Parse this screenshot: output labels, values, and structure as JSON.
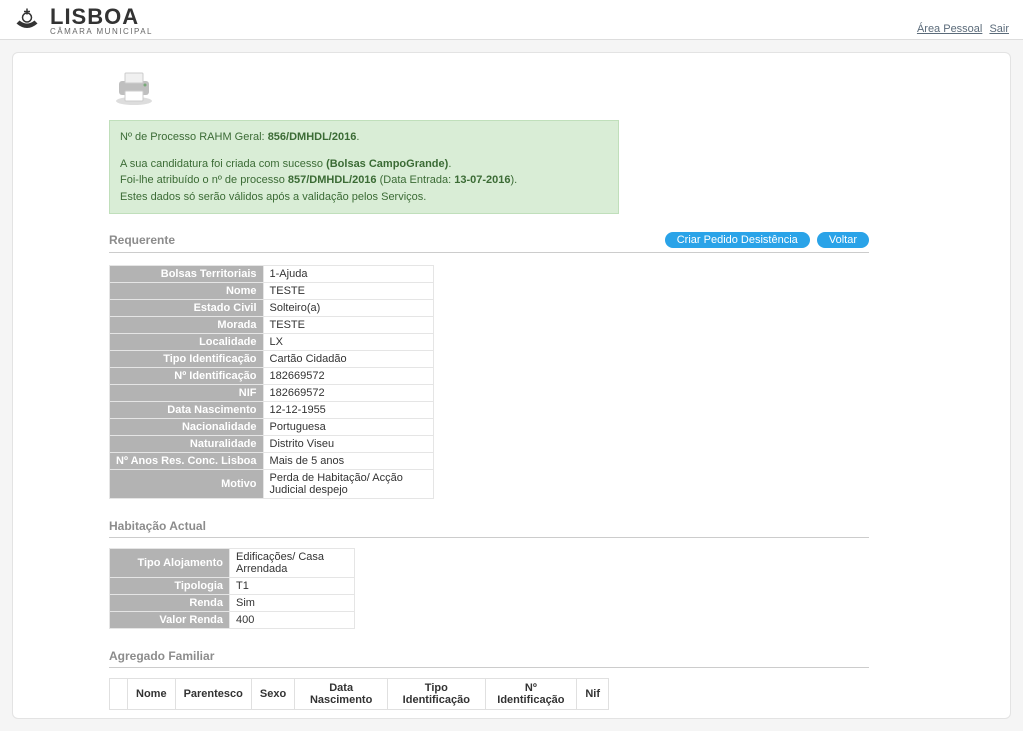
{
  "header": {
    "city": "LISBOA",
    "sub": "CÂMARA MUNICIPAL",
    "link_area_pessoal": "Área Pessoal",
    "link_sair": "Sair"
  },
  "alert": {
    "l1_a": "Nº de Processo RAHM Geral: ",
    "l1_b": "856/DMHDL/2016",
    "l1_c": ".",
    "l2_a": "A sua candidatura foi criada com sucesso ",
    "l2_b": "(Bolsas CampoGrande)",
    "l2_c": ".",
    "l3_a": "Foi-lhe atribuído o nº de processo ",
    "l3_b": "857/DMHDL/2016",
    "l3_c": " (Data Entrada: ",
    "l3_d": "13-07-2016",
    "l3_e": ").",
    "l4": "Estes dados só serão válidos após a validação pelos Serviços."
  },
  "section_requerente": {
    "title": "Requerente",
    "btn_desistencia": "Criar Pedido Desistência",
    "btn_voltar": "Voltar",
    "rows": [
      {
        "label": "Bolsas Territoriais",
        "value": "1-Ajuda"
      },
      {
        "label": "Nome",
        "value": "TESTE"
      },
      {
        "label": "Estado Civil",
        "value": "Solteiro(a)"
      },
      {
        "label": "Morada",
        "value": "TESTE"
      },
      {
        "label": "Localidade",
        "value": "LX"
      },
      {
        "label": "Tipo Identificação",
        "value": "Cartão Cidadão"
      },
      {
        "label": "Nº Identificação",
        "value": "182669572"
      },
      {
        "label": "NIF",
        "value": "182669572"
      },
      {
        "label": "Data Nascimento",
        "value": "12-12-1955"
      },
      {
        "label": "Nacionalidade",
        "value": "Portuguesa"
      },
      {
        "label": "Naturalidade",
        "value": "Distrito Viseu"
      },
      {
        "label": "Nº Anos Res. Conc. Lisboa",
        "value": "Mais de 5 anos"
      },
      {
        "label": "Motivo",
        "value": "Perda de Habitação/ Acção Judicial despejo"
      }
    ]
  },
  "section_habitacao": {
    "title": "Habitação Actual",
    "rows": [
      {
        "label": "Tipo Alojamento",
        "value": "Edificações/ Casa Arrendada"
      },
      {
        "label": "Tipologia",
        "value": "T1"
      },
      {
        "label": "Renda",
        "value": "Sim"
      },
      {
        "label": "Valor Renda",
        "value": "400"
      }
    ]
  },
  "section_agregado": {
    "title": "Agregado Familiar",
    "headers": [
      "Nome",
      "Parentesco",
      "Sexo",
      "Data Nascimento",
      "Tipo Identificação",
      "Nº Identificação",
      "Nif"
    ]
  }
}
